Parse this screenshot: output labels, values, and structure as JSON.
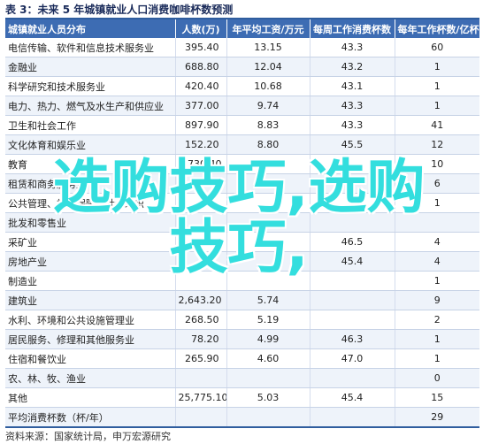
{
  "title": "表 3：未来 5 年城镇就业人口消费咖啡杯数预测",
  "headers": [
    "城镇就业人员分布",
    "人数(万)",
    "年平均工资/万元",
    "每周工作消费杯数",
    "每年工作杯数/亿杯"
  ],
  "rows": [
    {
      "industry": "电信传输、软件和信息技术服务业",
      "people": "395.40",
      "wage": "13.15",
      "weekly": "43.3",
      "yearly": "60"
    },
    {
      "industry": "金融业",
      "people": "688.80",
      "wage": "12.04",
      "weekly": "43.2",
      "yearly": "1"
    },
    {
      "industry": "科学研究和技术服务业",
      "people": "420.40",
      "wage": "10.68",
      "weekly": "43.1",
      "yearly": "1"
    },
    {
      "industry": "电力、热力、燃气及水生产和供应业",
      "people": "377.00",
      "wage": "9.74",
      "weekly": "43.3",
      "yearly": "1"
    },
    {
      "industry": "卫生和社会工作",
      "people": "897.90",
      "wage": "8.83",
      "weekly": "43.3",
      "yearly": "41"
    },
    {
      "industry": "文化体育和娱乐业",
      "people": "152.20",
      "wage": "8.80",
      "weekly": "45.5",
      "yearly": "12"
    },
    {
      "industry": "教育",
      "people": "1,730.40",
      "wage": "",
      "weekly": "",
      "yearly": "10"
    },
    {
      "industry": "租赁和商务服务业",
      "people": "",
      "wage": "",
      "weekly": "",
      "yearly": "6"
    },
    {
      "industry": "公共管理、社会保障和社会组织",
      "people": "",
      "wage": "",
      "weekly": "",
      "yearly": "1"
    },
    {
      "industry": "批发和零售业",
      "people": "",
      "wage": "",
      "weekly": "",
      "yearly": ""
    },
    {
      "industry": "采矿业",
      "people": "",
      "wage": "",
      "weekly": "46.5",
      "yearly": "4"
    },
    {
      "industry": "房地产业",
      "people": "",
      "wage": "",
      "weekly": "45.4",
      "yearly": "4"
    },
    {
      "industry": "制造业",
      "people": "",
      "wage": "",
      "weekly": "",
      "yearly": "1"
    },
    {
      "industry": "建筑业",
      "people": "2,643.20",
      "wage": "5.74",
      "weekly": "",
      "yearly": "9"
    },
    {
      "industry": "水利、环境和公共设施管理业",
      "people": "268.50",
      "wage": "5.19",
      "weekly": "",
      "yearly": "2"
    },
    {
      "industry": "居民服务、修理和其他服务业",
      "people": "78.20",
      "wage": "4.99",
      "weekly": "46.3",
      "yearly": "1"
    },
    {
      "industry": "住宿和餐饮业",
      "people": "265.90",
      "wage": "4.60",
      "weekly": "47.0",
      "yearly": "1"
    },
    {
      "industry": "农、林、牧、渔业",
      "people": "",
      "wage": "",
      "weekly": "",
      "yearly": "0"
    },
    {
      "industry": "其他",
      "people": "25,775.10",
      "wage": "5.03",
      "weekly": "45.4",
      "yearly": "15"
    },
    {
      "industry": "平均消费杯数（杯/年）",
      "people": "",
      "wage": "",
      "weekly": "",
      "yearly": "29"
    }
  ],
  "source": "资料来源：国家统计局，申万宏源研究",
  "overlay": {
    "line1": "选购技巧,选购",
    "line2": "技巧,"
  }
}
